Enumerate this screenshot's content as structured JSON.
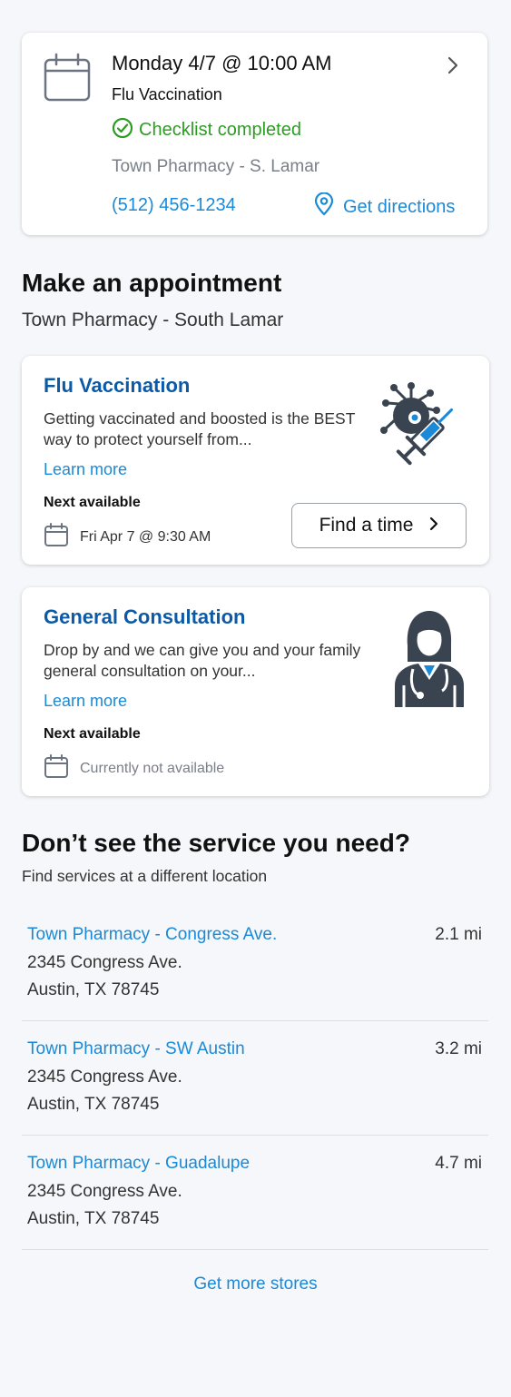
{
  "appointment": {
    "date_time": "Monday 4/7 @ 10:00 AM",
    "service": "Flu Vaccination",
    "checklist_status": "Checklist completed",
    "store": "Town Pharmacy - S. Lamar",
    "phone": "(512) 456-1234",
    "directions_label": "Get directions"
  },
  "make_appointment": {
    "title": "Make an appointment",
    "subtitle": "Town Pharmacy - South Lamar",
    "services": [
      {
        "title": "Flu Vaccination",
        "description": "Getting vaccinated and boosted is the BEST way to protect yourself from...",
        "learn_more": "Learn more",
        "next_label": "Next available",
        "next_slot": "Fri Apr 7 @ 9:30 AM",
        "find_label": "Find a time",
        "illustration": "vaccine-syringe-virus-icon"
      },
      {
        "title": "General Consultation",
        "description": "Drop by and we can give you and your family general consultation on your...",
        "learn_more": "Learn more",
        "next_label": "Next available",
        "next_slot": "Currently not available",
        "illustration": "doctor-icon"
      }
    ]
  },
  "other_locations": {
    "title": "Don’t see the service you need?",
    "subtitle": "Find services at a different location",
    "locations": [
      {
        "name": "Town Pharmacy - Congress Ave.",
        "distance": "2.1 mi",
        "address1": "2345 Congress Ave.",
        "address2": "Austin, TX 78745"
      },
      {
        "name": "Town Pharmacy - SW Austin",
        "distance": "3.2 mi",
        "address1": "2345 Congress Ave.",
        "address2": "Austin, TX 78745"
      },
      {
        "name": "Town Pharmacy - Guadalupe",
        "distance": "4.7 mi",
        "address1": "2345 Congress Ave.",
        "address2": "Austin, TX 78745"
      }
    ],
    "more_label": "Get more stores"
  },
  "colors": {
    "link": "#1a8ad8",
    "heading_blue": "#0c5aa6",
    "success": "#2e9b24",
    "muted": "#7a7f87",
    "background": "#f5f7fa"
  }
}
